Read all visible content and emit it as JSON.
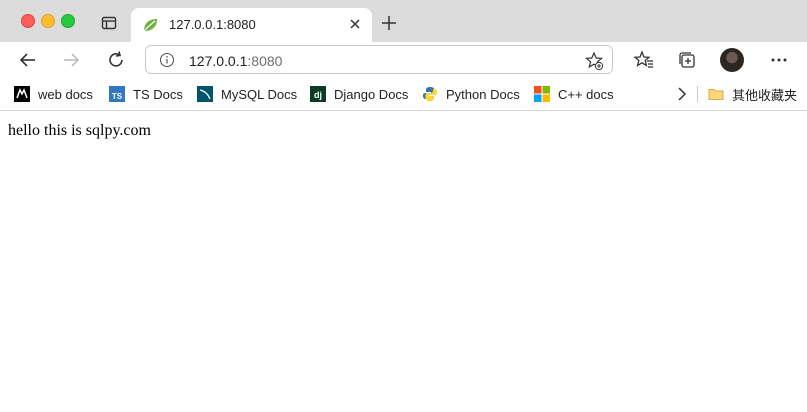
{
  "tab": {
    "title": "127.0.0.1:8080",
    "favicon_color": "#6db33f"
  },
  "address_bar": {
    "host": "127.0.0.1",
    "port": ":8080"
  },
  "bookmarks": [
    {
      "label": "web docs",
      "icon": "mdn-icon"
    },
    {
      "label": "TS Docs",
      "icon": "typescript-icon"
    },
    {
      "label": "MySQL Docs",
      "icon": "mysql-icon"
    },
    {
      "label": "Django Docs",
      "icon": "django-icon"
    },
    {
      "label": "Python Docs",
      "icon": "python-icon"
    },
    {
      "label": "C++ docs",
      "icon": "windows-icon"
    }
  ],
  "other_favorites_label": "其他收藏夹",
  "page": {
    "text": "hello this is sqlpy.com"
  },
  "colors": {
    "titlebar": "#dcdcdc",
    "close": "#fe5f57",
    "minimize": "#febc2e",
    "maximize": "#28c840"
  }
}
